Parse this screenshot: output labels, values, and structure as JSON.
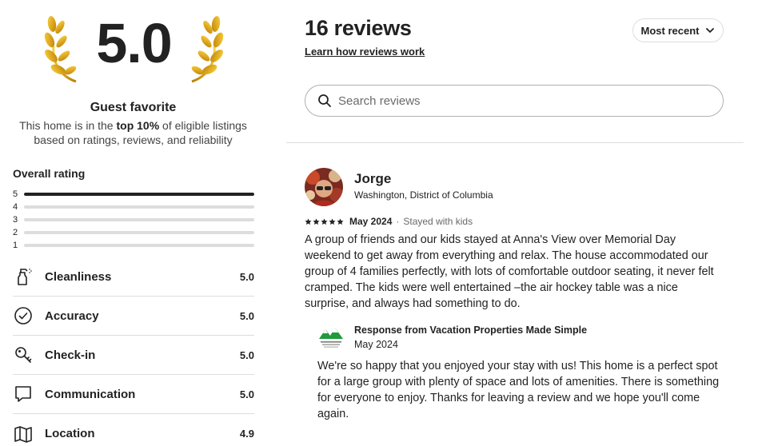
{
  "summary": {
    "score": "5.0",
    "badge_title": "Guest favorite",
    "desc_pre": "This home is in the ",
    "desc_bold": "top 10%",
    "desc_post": " of eligible listings based on ratings, reviews, and reliability"
  },
  "overall": {
    "title": "Overall rating",
    "distribution": [
      {
        "label": "5",
        "fraction": 1.0
      },
      {
        "label": "4",
        "fraction": 0.0
      },
      {
        "label": "3",
        "fraction": 0.0
      },
      {
        "label": "2",
        "fraction": 0.0
      },
      {
        "label": "1",
        "fraction": 0.0
      }
    ]
  },
  "categories": [
    {
      "label": "Cleanliness",
      "value": "5.0",
      "icon": "spray-bottle-icon"
    },
    {
      "label": "Accuracy",
      "value": "5.0",
      "icon": "check-circle-icon"
    },
    {
      "label": "Check-in",
      "value": "5.0",
      "icon": "key-icon"
    },
    {
      "label": "Communication",
      "value": "5.0",
      "icon": "chat-bubble-icon"
    },
    {
      "label": "Location",
      "value": "4.9",
      "icon": "map-icon"
    }
  ],
  "header": {
    "count_label": "16 reviews",
    "learn_link": "Learn how reviews work",
    "sort_label": "Most recent"
  },
  "search": {
    "placeholder": "Search reviews",
    "value": ""
  },
  "review": {
    "name": "Jorge",
    "location": "Washington, District of Columbia",
    "rating": 5,
    "date": "May 2024",
    "separator": "·",
    "stay_type": "Stayed with kids",
    "text": "A group of friends and our kids stayed at Anna's View over Memorial Day weekend to get away from everything and relax. The house accommodated our group of 4 families perfectly, with lots of comfortable outdoor seating, it never felt cramped. The kids were well entertained –the air hockey table was a nice surprise, and always had something to do.",
    "response": {
      "title": "Response from Vacation Properties Made Simple",
      "date": "May 2024",
      "text": "We're so happy that you enjoyed your stay with us! This home is a perfect spot for a large group with plenty of space and lots of amenities. There is something for everyone to enjoy. Thanks for leaving a review and we hope you'll come again."
    }
  },
  "colors": {
    "text": "#222222",
    "muted": "#6a6a6a",
    "border": "#dddddd",
    "laurel_gold": "#e8b830"
  }
}
